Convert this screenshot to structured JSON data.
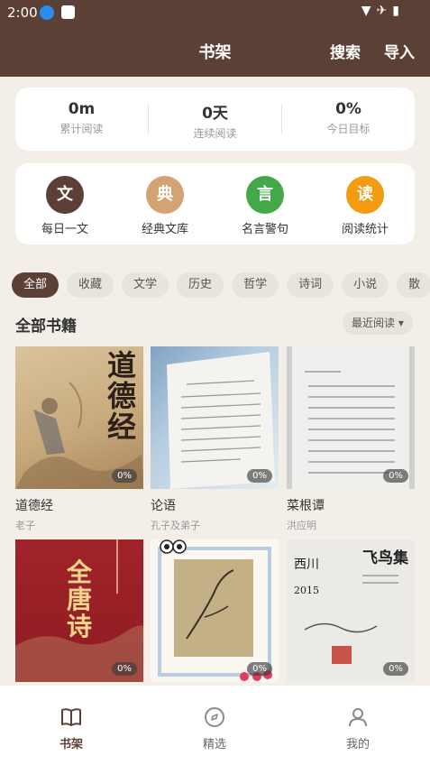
{
  "status": {
    "time": "2:00"
  },
  "header": {
    "title": "书架",
    "search_label": "搜索",
    "import_label": "导入"
  },
  "stats": [
    {
      "value": "0m",
      "label": "累计阅读"
    },
    {
      "value": "0天",
      "label": "连续阅读"
    },
    {
      "value": "0%",
      "label": "今日目标"
    }
  ],
  "features": [
    {
      "glyph": "文",
      "label": "每日一文",
      "color": "#5b4035"
    },
    {
      "glyph": "典",
      "label": "经典文库",
      "color": "#d4a373"
    },
    {
      "glyph": "言",
      "label": "名言警句",
      "color": "#43a847"
    },
    {
      "glyph": "读",
      "label": "阅读统计",
      "color": "#f39c12"
    }
  ],
  "categories": [
    "全部",
    "收藏",
    "文学",
    "历史",
    "哲学",
    "诗词",
    "小说",
    "散"
  ],
  "section": {
    "title": "全部书籍",
    "sort_label": "最近阅读 ▾"
  },
  "books": [
    {
      "title": "道德经",
      "author": "老子",
      "progress": "0%",
      "cover_text": "道德经"
    },
    {
      "title": "论语",
      "author": "孔子及弟子",
      "progress": "0%"
    },
    {
      "title": "菜根谭",
      "author": "洪应明",
      "progress": "0%"
    },
    {
      "title": "",
      "author": "",
      "progress": "0%",
      "cover_text": "全唐诗"
    },
    {
      "title": "",
      "author": "",
      "progress": "0%"
    },
    {
      "title": "",
      "author": "",
      "progress": "0%",
      "cover_text": "飞鸟集"
    }
  ],
  "tabs": [
    {
      "label": "书架",
      "icon": "book-icon",
      "active": true
    },
    {
      "label": "精选",
      "icon": "compass-icon",
      "active": false
    },
    {
      "label": "我的",
      "icon": "person-icon",
      "active": false
    }
  ],
  "colors": {
    "brand": "#5b4035",
    "background": "#f3efe8"
  }
}
